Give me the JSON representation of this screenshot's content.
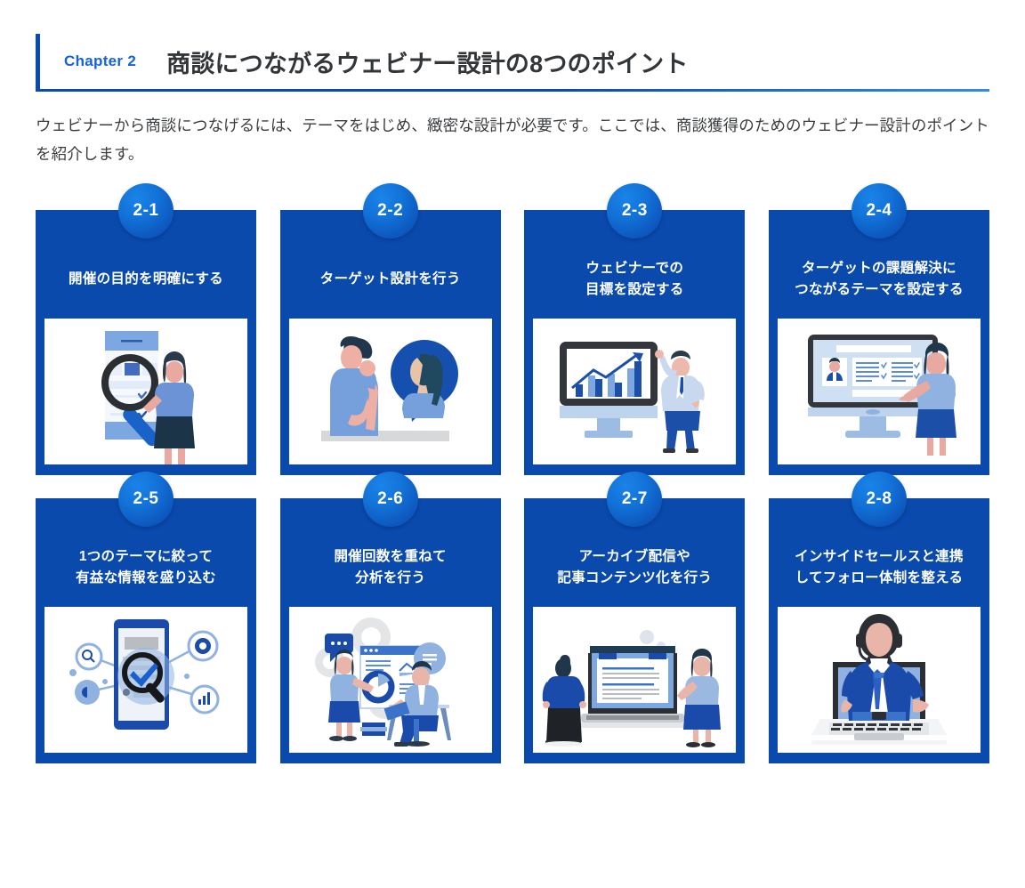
{
  "header": {
    "chapter_label": "Chapter 2",
    "title": "商談につながるウェビナー設計の8つのポイント",
    "accent_color": "#0b4bb0",
    "label_color": "#1363e0"
  },
  "lead": {
    "text": "ウェビナーから商談につなげるには、テーマをはじめ、緻密な設計が必要です。ここでは、商談獲得のためのウェビナー設計のポイントを紹介します。"
  },
  "theme": {
    "card_bg": "#0a4aad",
    "badge_color": "#1272d8",
    "text_color": "#ffffff"
  },
  "cards": [
    {
      "badge": "2-1",
      "title_lines": [
        "開催の目的を明確にする"
      ],
      "illustration": "magnifier-checklist-woman-illustration"
    },
    {
      "badge": "2-2",
      "title_lines": [
        "ターゲット設計を行う"
      ],
      "illustration": "man-thinking-persona-bubble-illustration"
    },
    {
      "badge": "2-3",
      "title_lines": [
        "ウェビナーでの",
        "目標を設定する"
      ],
      "illustration": "monitor-growth-chart-man-illustration"
    },
    {
      "badge": "2-4",
      "title_lines": [
        "ターゲットの課題解決に",
        "つながるテーマを設定する"
      ],
      "illustration": "monitor-profile-checklist-woman-illustration"
    },
    {
      "badge": "2-5",
      "title_lines": [
        "1つのテーマに絞って",
        "有益な情報を盛り込む"
      ],
      "illustration": "smartphone-magnifier-network-illustration"
    },
    {
      "badge": "2-6",
      "title_lines": [
        "開催回数を重ねて",
        "分析を行う"
      ],
      "illustration": "team-dashboard-analysis-illustration"
    },
    {
      "badge": "2-7",
      "title_lines": [
        "アーカイブ配信や",
        "記事コンテンツ化を行う"
      ],
      "illustration": "laptop-article-two-people-illustration"
    },
    {
      "badge": "2-8",
      "title_lines": [
        "インサイドセールスと連携",
        "してフォロー体制を整える"
      ],
      "illustration": "headset-agent-laptop-illustration"
    }
  ]
}
